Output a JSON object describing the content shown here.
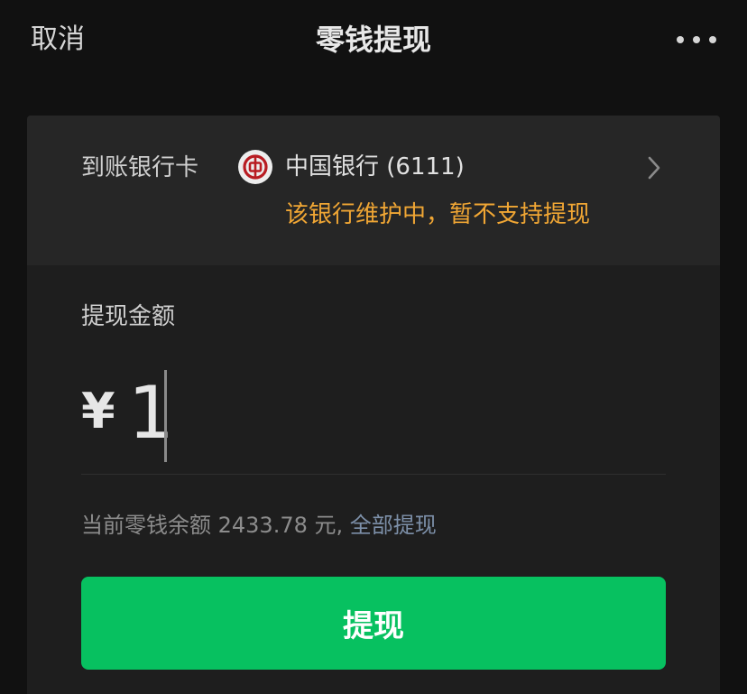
{
  "nav": {
    "cancel_label": "取消",
    "title": "零钱提现",
    "more_icon": "more-dots-icon"
  },
  "bank": {
    "label": "到账银行卡",
    "logo_icon": "bank-of-china-logo-icon",
    "name": "中国银行 (6111)",
    "warning": "该银行维护中，暂不支持提现",
    "chevron_icon": "chevron-right-icon"
  },
  "amount": {
    "label": "提现金额",
    "currency_symbol": "¥",
    "value": "1"
  },
  "balance": {
    "text": "当前零钱余额 2433.78 元, ",
    "withdraw_all_label": "全部提现"
  },
  "submit": {
    "label": "提现"
  },
  "colors": {
    "background": "#111111",
    "card": "#1e1e1e",
    "bank_section": "#262626",
    "warning": "#f0a634",
    "link": "#7d90a9",
    "primary_button": "#07c160",
    "bank_logo_red": "#b81c22"
  }
}
